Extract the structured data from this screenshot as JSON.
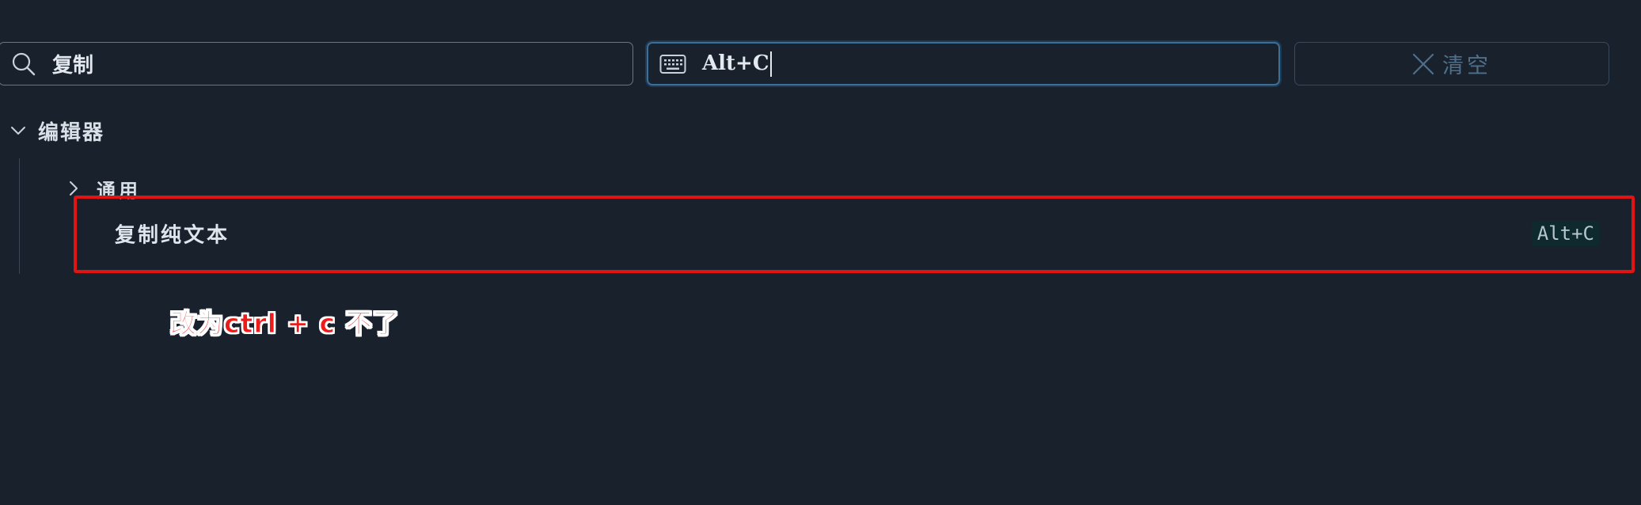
{
  "search": {
    "icon": "search-icon",
    "value": "复制"
  },
  "shortcut_search": {
    "icon": "keyboard-icon",
    "value": "Alt+C"
  },
  "clear_button": {
    "icon": "close-icon",
    "label": "清空"
  },
  "tree": {
    "group": {
      "label": "编辑器",
      "expanded": true,
      "icon": "chevron-down-icon"
    },
    "subgroup": {
      "label": "通用",
      "expanded": false,
      "icon": "chevron-right-icon"
    },
    "command": {
      "label": "复制纯文本",
      "keybinding": "Alt+C"
    }
  },
  "annotation": {
    "text": "改为ctrl + c 不了",
    "color": "#ee1b1b"
  },
  "colors": {
    "background": "#19212d",
    "highlight_border": "#e11313",
    "focus_border": "#3b6f97"
  }
}
